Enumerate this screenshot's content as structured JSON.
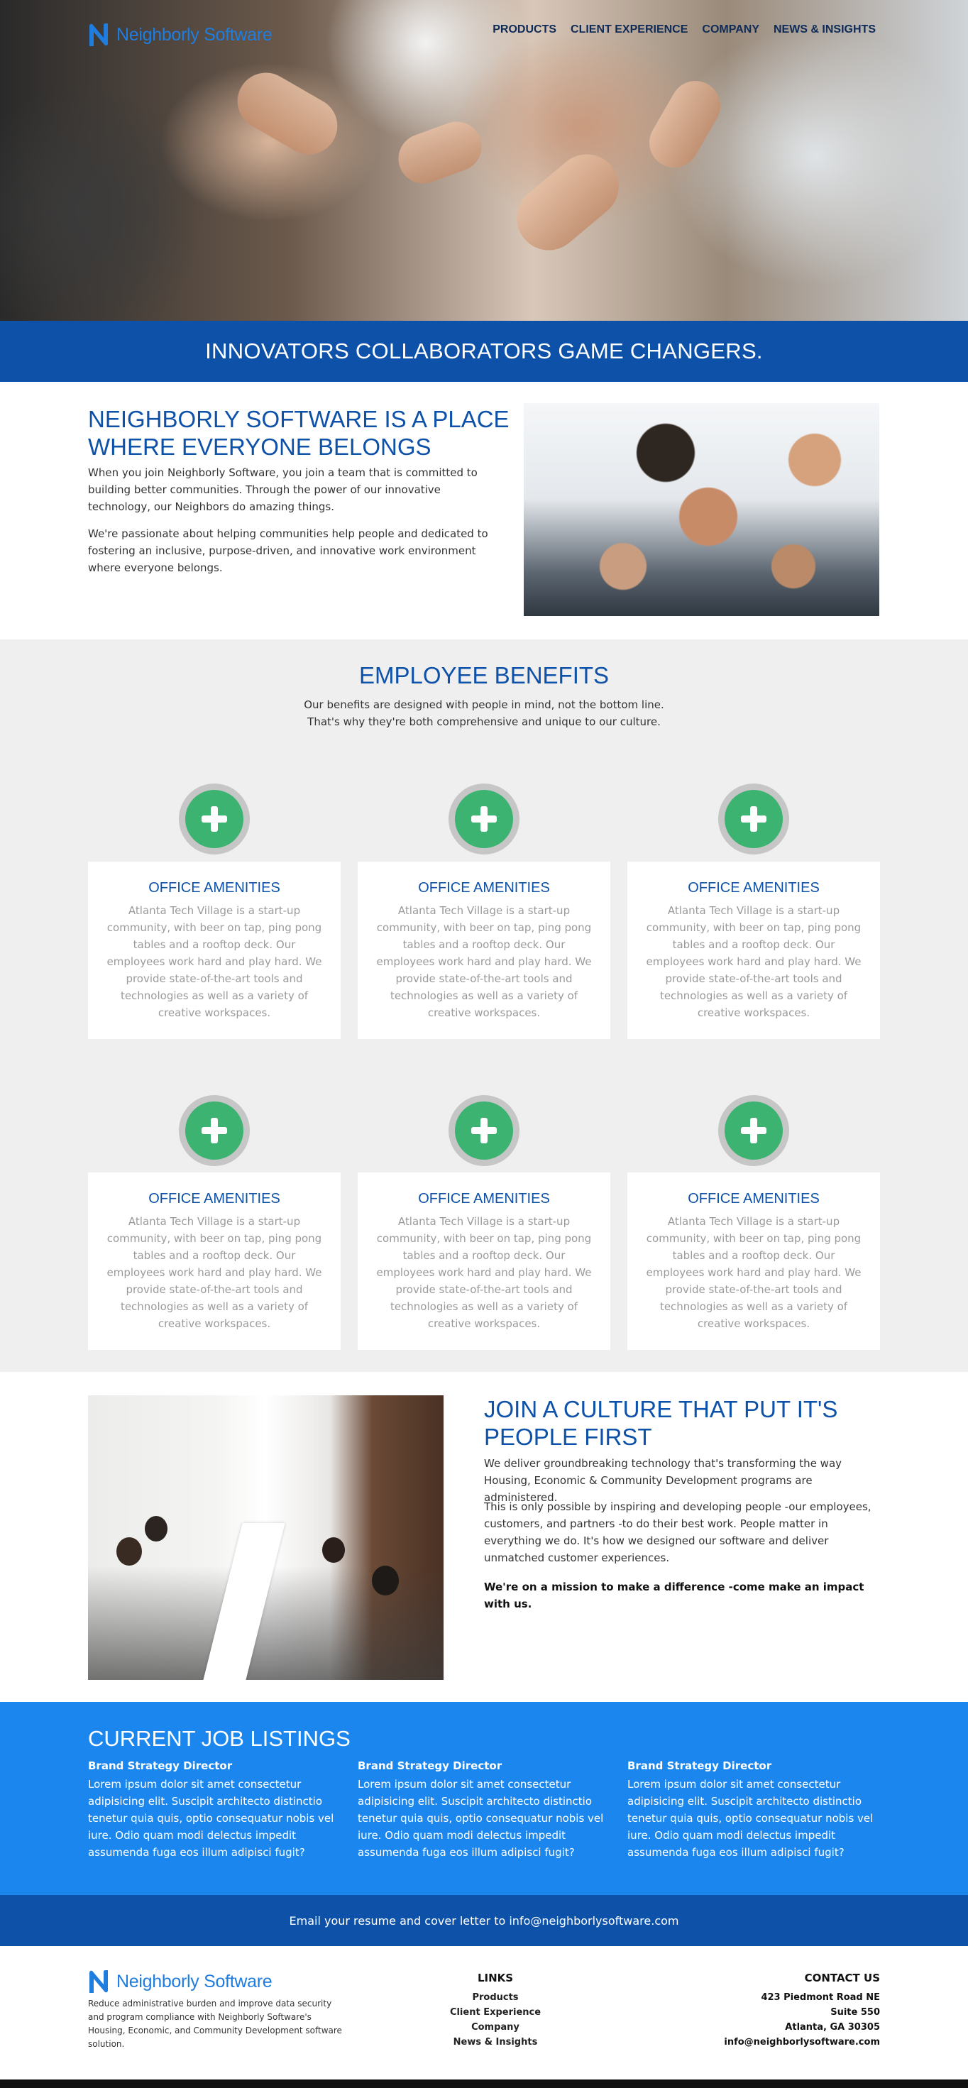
{
  "brand": {
    "name": "Neighborly Software",
    "color": "#1f7de0"
  },
  "nav": [
    {
      "label": "PRODUCTS"
    },
    {
      "label": "CLIENT EXPERIENCE"
    },
    {
      "label": "COMPANY"
    },
    {
      "label": "NEWS & INSIGHTS"
    }
  ],
  "banner": {
    "text": "INNOVATORS COLLABORATORS GAME CHANGERS."
  },
  "intro": {
    "title": "NEIGHBORLY SOFTWARE IS A PLACE WHERE EVERYONE BELONGS",
    "p1": "When you join Neighborly Software, you join a team that is committed to building better communities. Through the power of our innovative technology, our Neighbors do amazing things.",
    "p2": "We're passionate about helping communities help people and dedicated to fostering an inclusive, purpose-driven, and innovative work environment where everyone belongs."
  },
  "benefits": {
    "title": "EMPLOYEE BENEFITS",
    "sub1": "Our benefits are designed with people in mind, not the bottom line.",
    "sub2": "That's why they're both comprehensive and unique to our culture.",
    "cards": [
      {
        "title": "OFFICE AMENITIES",
        "text": "Atlanta Tech Village is a start-up community, with beer on tap, ping pong tables and a rooftop deck. Our employees work hard and play hard. We provide state-of-the-art tools and technologies as well as a variety of creative workspaces."
      },
      {
        "title": "OFFICE AMENITIES",
        "text": "Atlanta Tech Village is a start-up community, with beer on tap, ping pong tables and a rooftop deck. Our employees work hard and play hard. We provide state-of-the-art tools and technologies as well as a variety of creative workspaces."
      },
      {
        "title": "OFFICE AMENITIES",
        "text": "Atlanta Tech Village is a start-up community, with beer on tap, ping pong tables and a rooftop deck. Our employees work hard and play hard. We provide state-of-the-art tools and technologies as well as a variety of creative workspaces."
      },
      {
        "title": "OFFICE AMENITIES",
        "text": "Atlanta Tech Village is a start-up community, with beer on tap, ping pong tables and a rooftop deck. Our employees work hard and play hard. We provide state-of-the-art tools and technologies as well as a variety of creative workspaces."
      },
      {
        "title": "OFFICE AMENITIES",
        "text": "Atlanta Tech Village is a start-up community, with beer on tap, ping pong tables and a rooftop deck. Our employees work hard and play hard. We provide state-of-the-art tools and technologies as well as a variety of creative workspaces."
      },
      {
        "title": "OFFICE AMENITIES",
        "text": "Atlanta Tech Village is a start-up community, with beer on tap, ping pong tables and a rooftop deck. Our employees work hard and play hard. We provide state-of-the-art tools and technologies as well as a variety of creative workspaces."
      }
    ],
    "icon": "plus-circle-icon",
    "icon_color": "#3cb371"
  },
  "culture": {
    "title": "JOIN A CULTURE THAT PUT IT'S PEOPLE FIRST",
    "p1": "We deliver groundbreaking technology that's transforming the way Housing, Economic & Community Development programs are administered.",
    "p2": "This is only possible by inspiring and developing people -our employees, customers, and partners -to do their best work. People matter in everything we do. It's how we designed our software and deliver unmatched customer experiences.",
    "p3": "We're on a mission to make a difference -come make an impact with us."
  },
  "jobs": {
    "title": "CURRENT JOB LISTINGS",
    "items": [
      {
        "title": "Brand Strategy Director",
        "text": "Lorem ipsum dolor sit amet consectetur adipisicing elit. Suscipit architecto distinctio tenetur quia quis, optio consequatur nobis vel iure. Odio quam modi delectus impedit assumenda fuga eos illum adipisci fugit?"
      },
      {
        "title": "Brand Strategy Director",
        "text": "Lorem ipsum dolor sit amet consectetur adipisicing elit. Suscipit architecto distinctio tenetur quia quis, optio consequatur nobis vel iure. Odio quam modi delectus impedit assumenda fuga eos illum adipisci fugit?"
      },
      {
        "title": "Brand Strategy Director",
        "text": "Lorem ipsum dolor sit amet consectetur adipisicing elit. Suscipit architecto distinctio tenetur quia quis, optio consequatur nobis vel iure. Odio quam modi delectus impedit assumenda fuga eos illum adipisci fugit?"
      }
    ]
  },
  "email": {
    "text": "Email your resume and cover letter to info@neighborlysoftware.com"
  },
  "footer": {
    "desc": "Reduce administrative burden and improve data security and program compliance with Neighborly Software's Housing, Economic, and Community Development software solution.",
    "links_title": "LINKS",
    "links": [
      "Products",
      "Client Experience",
      "Company",
      "News & Insights"
    ],
    "contact_title": "CONTACT US",
    "address1": "423 Piedmont Road NE",
    "address2": "Suite 550",
    "address3": "Atlanta, GA 30305",
    "contact_email": "info@neighborlysoftware.com"
  },
  "colors": {
    "primary_dark": "#0d51a8",
    "primary_light": "#1b87ee",
    "grey_bg": "#efefef"
  }
}
